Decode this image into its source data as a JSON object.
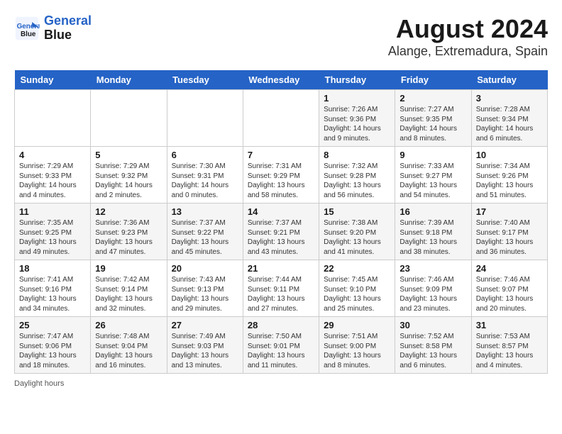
{
  "header": {
    "logo_line1": "General",
    "logo_line2": "Blue",
    "title": "August 2024",
    "subtitle": "Alange, Extremadura, Spain"
  },
  "days_of_week": [
    "Sunday",
    "Monday",
    "Tuesday",
    "Wednesday",
    "Thursday",
    "Friday",
    "Saturday"
  ],
  "weeks": [
    [
      {
        "num": "",
        "detail": ""
      },
      {
        "num": "",
        "detail": ""
      },
      {
        "num": "",
        "detail": ""
      },
      {
        "num": "",
        "detail": ""
      },
      {
        "num": "1",
        "detail": "Sunrise: 7:26 AM\nSunset: 9:36 PM\nDaylight: 14 hours\nand 9 minutes."
      },
      {
        "num": "2",
        "detail": "Sunrise: 7:27 AM\nSunset: 9:35 PM\nDaylight: 14 hours\nand 8 minutes."
      },
      {
        "num": "3",
        "detail": "Sunrise: 7:28 AM\nSunset: 9:34 PM\nDaylight: 14 hours\nand 6 minutes."
      }
    ],
    [
      {
        "num": "4",
        "detail": "Sunrise: 7:29 AM\nSunset: 9:33 PM\nDaylight: 14 hours\nand 4 minutes."
      },
      {
        "num": "5",
        "detail": "Sunrise: 7:29 AM\nSunset: 9:32 PM\nDaylight: 14 hours\nand 2 minutes."
      },
      {
        "num": "6",
        "detail": "Sunrise: 7:30 AM\nSunset: 9:31 PM\nDaylight: 14 hours\nand 0 minutes."
      },
      {
        "num": "7",
        "detail": "Sunrise: 7:31 AM\nSunset: 9:29 PM\nDaylight: 13 hours\nand 58 minutes."
      },
      {
        "num": "8",
        "detail": "Sunrise: 7:32 AM\nSunset: 9:28 PM\nDaylight: 13 hours\nand 56 minutes."
      },
      {
        "num": "9",
        "detail": "Sunrise: 7:33 AM\nSunset: 9:27 PM\nDaylight: 13 hours\nand 54 minutes."
      },
      {
        "num": "10",
        "detail": "Sunrise: 7:34 AM\nSunset: 9:26 PM\nDaylight: 13 hours\nand 51 minutes."
      }
    ],
    [
      {
        "num": "11",
        "detail": "Sunrise: 7:35 AM\nSunset: 9:25 PM\nDaylight: 13 hours\nand 49 minutes."
      },
      {
        "num": "12",
        "detail": "Sunrise: 7:36 AM\nSunset: 9:23 PM\nDaylight: 13 hours\nand 47 minutes."
      },
      {
        "num": "13",
        "detail": "Sunrise: 7:37 AM\nSunset: 9:22 PM\nDaylight: 13 hours\nand 45 minutes."
      },
      {
        "num": "14",
        "detail": "Sunrise: 7:37 AM\nSunset: 9:21 PM\nDaylight: 13 hours\nand 43 minutes."
      },
      {
        "num": "15",
        "detail": "Sunrise: 7:38 AM\nSunset: 9:20 PM\nDaylight: 13 hours\nand 41 minutes."
      },
      {
        "num": "16",
        "detail": "Sunrise: 7:39 AM\nSunset: 9:18 PM\nDaylight: 13 hours\nand 38 minutes."
      },
      {
        "num": "17",
        "detail": "Sunrise: 7:40 AM\nSunset: 9:17 PM\nDaylight: 13 hours\nand 36 minutes."
      }
    ],
    [
      {
        "num": "18",
        "detail": "Sunrise: 7:41 AM\nSunset: 9:16 PM\nDaylight: 13 hours\nand 34 minutes."
      },
      {
        "num": "19",
        "detail": "Sunrise: 7:42 AM\nSunset: 9:14 PM\nDaylight: 13 hours\nand 32 minutes."
      },
      {
        "num": "20",
        "detail": "Sunrise: 7:43 AM\nSunset: 9:13 PM\nDaylight: 13 hours\nand 29 minutes."
      },
      {
        "num": "21",
        "detail": "Sunrise: 7:44 AM\nSunset: 9:11 PM\nDaylight: 13 hours\nand 27 minutes."
      },
      {
        "num": "22",
        "detail": "Sunrise: 7:45 AM\nSunset: 9:10 PM\nDaylight: 13 hours\nand 25 minutes."
      },
      {
        "num": "23",
        "detail": "Sunrise: 7:46 AM\nSunset: 9:09 PM\nDaylight: 13 hours\nand 23 minutes."
      },
      {
        "num": "24",
        "detail": "Sunrise: 7:46 AM\nSunset: 9:07 PM\nDaylight: 13 hours\nand 20 minutes."
      }
    ],
    [
      {
        "num": "25",
        "detail": "Sunrise: 7:47 AM\nSunset: 9:06 PM\nDaylight: 13 hours\nand 18 minutes."
      },
      {
        "num": "26",
        "detail": "Sunrise: 7:48 AM\nSunset: 9:04 PM\nDaylight: 13 hours\nand 16 minutes."
      },
      {
        "num": "27",
        "detail": "Sunrise: 7:49 AM\nSunset: 9:03 PM\nDaylight: 13 hours\nand 13 minutes."
      },
      {
        "num": "28",
        "detail": "Sunrise: 7:50 AM\nSunset: 9:01 PM\nDaylight: 13 hours\nand 11 minutes."
      },
      {
        "num": "29",
        "detail": "Sunrise: 7:51 AM\nSunset: 9:00 PM\nDaylight: 13 hours\nand 8 minutes."
      },
      {
        "num": "30",
        "detail": "Sunrise: 7:52 AM\nSunset: 8:58 PM\nDaylight: 13 hours\nand 6 minutes."
      },
      {
        "num": "31",
        "detail": "Sunrise: 7:53 AM\nSunset: 8:57 PM\nDaylight: 13 hours\nand 4 minutes."
      }
    ]
  ],
  "footer": "Daylight hours"
}
